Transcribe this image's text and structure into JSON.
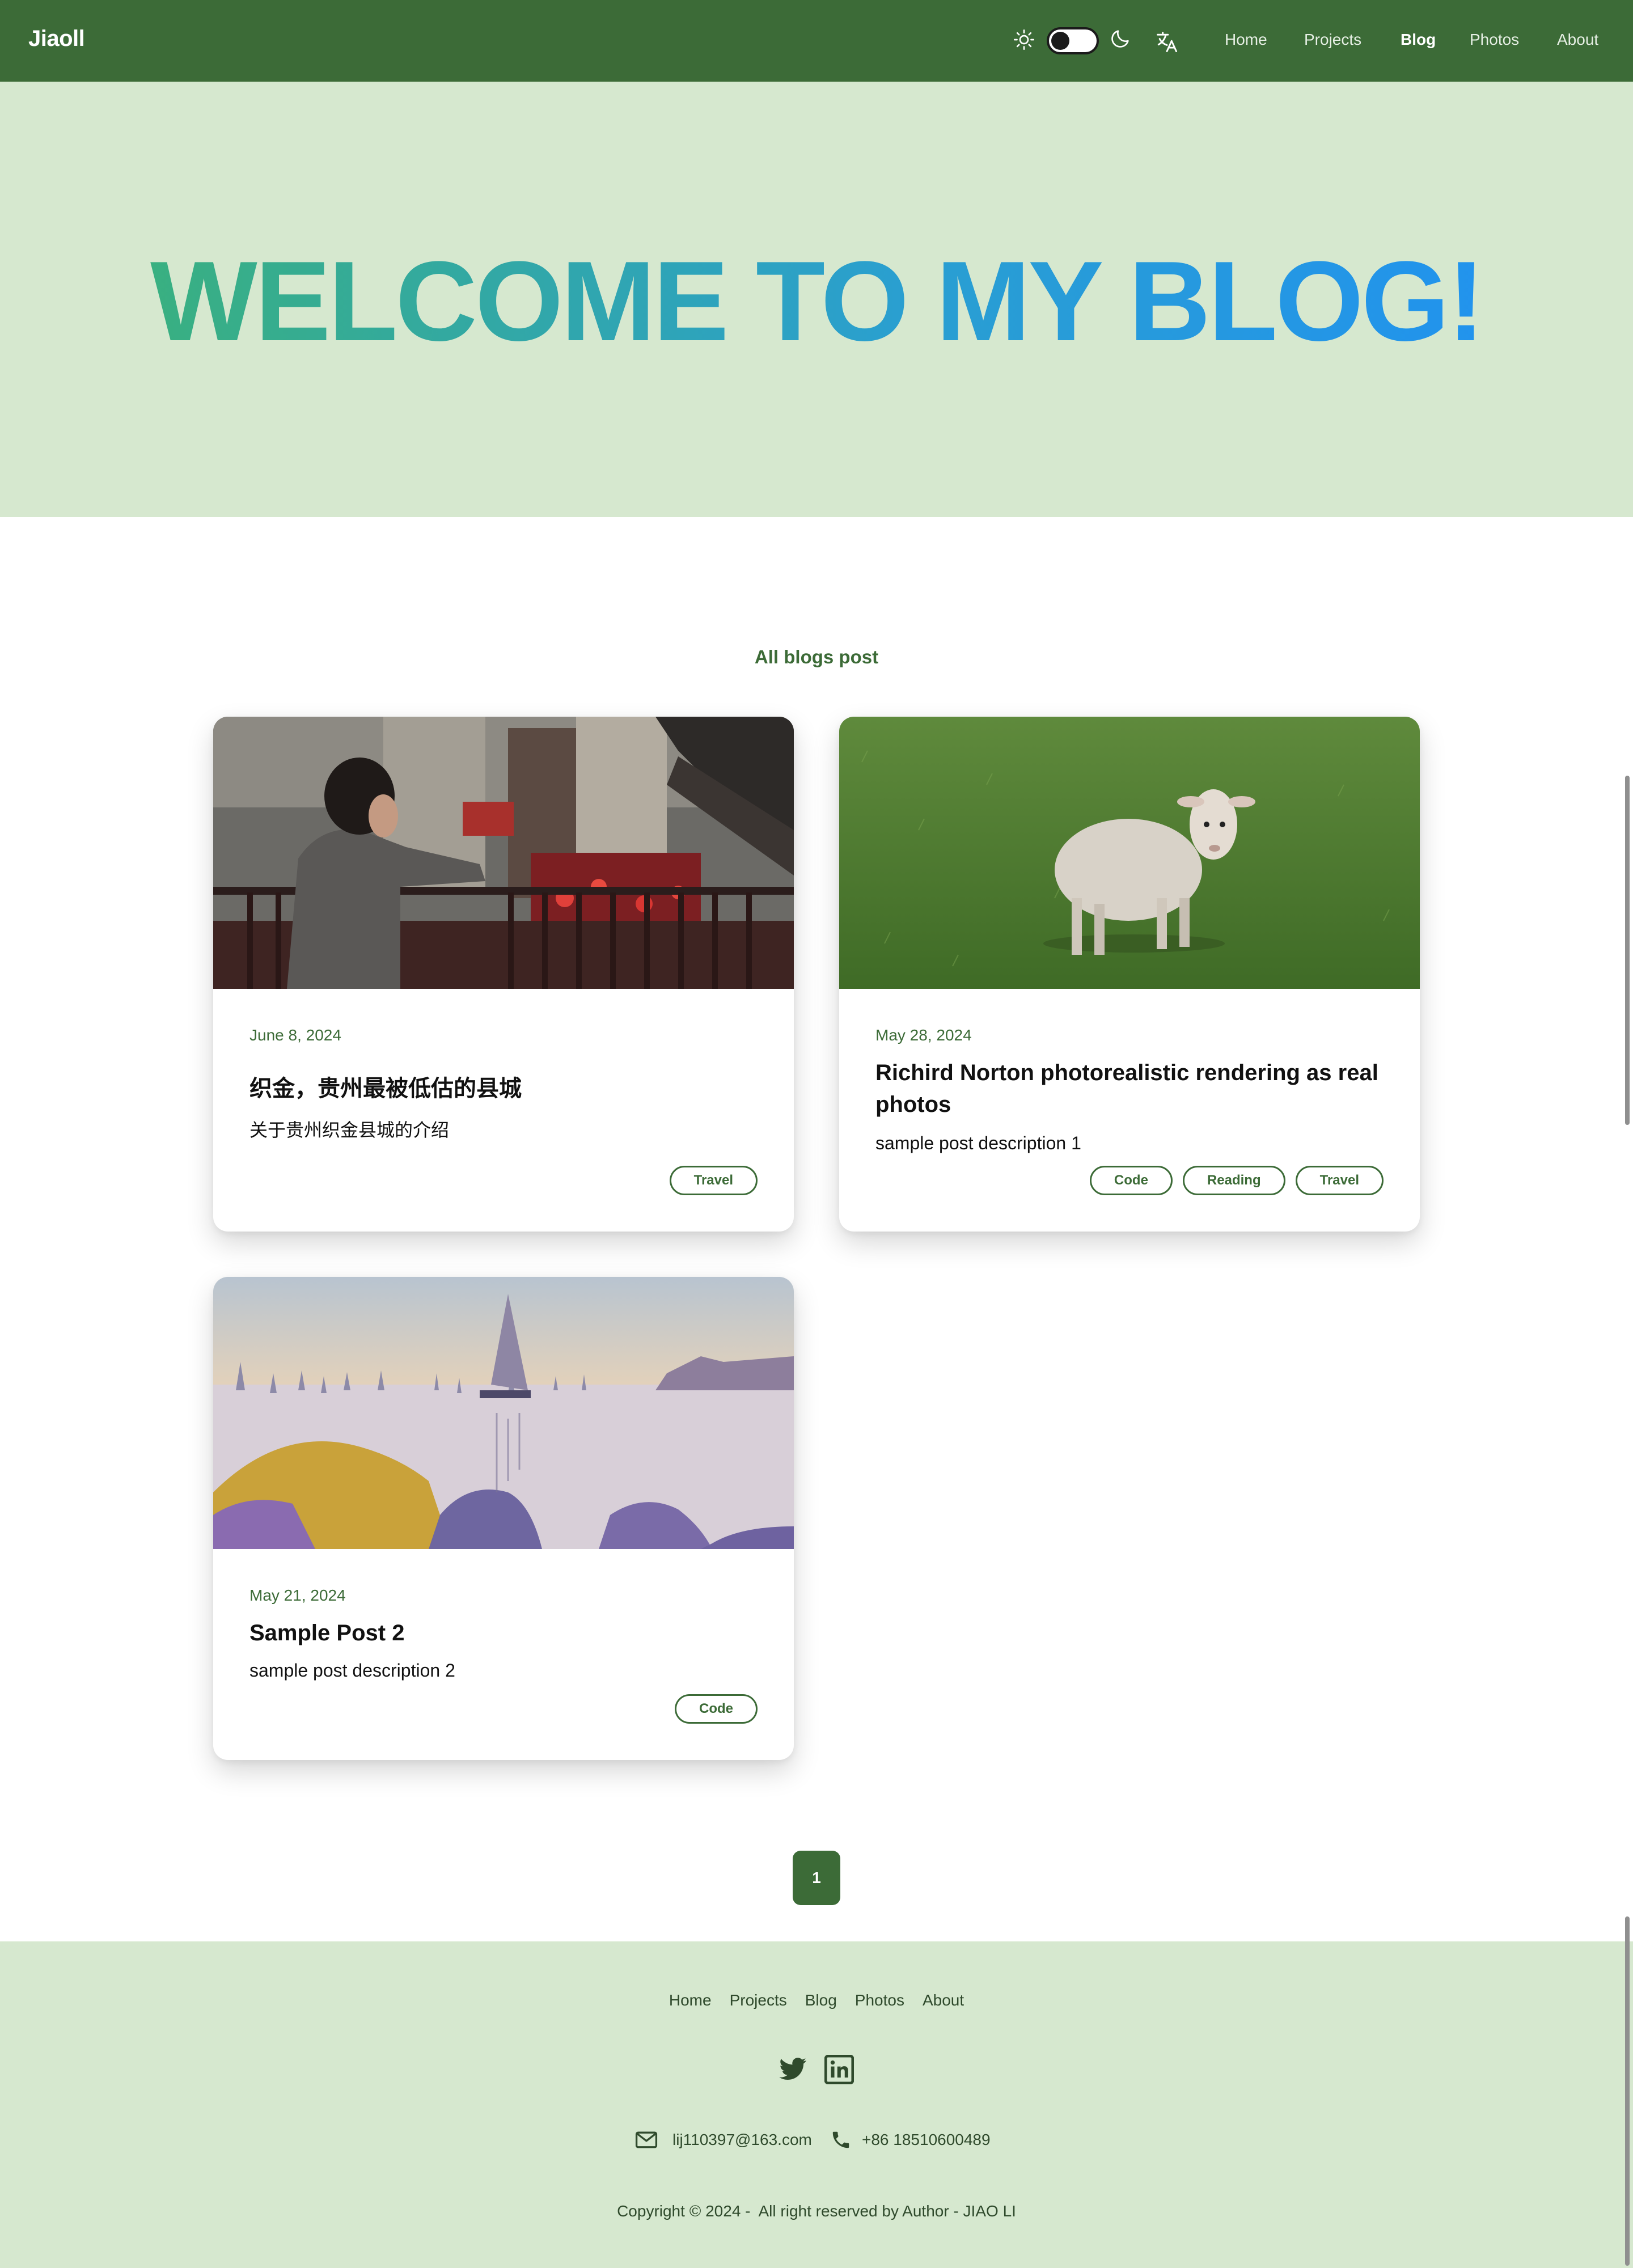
{
  "nav": {
    "brand": "Jiaoll",
    "links": [
      "Home",
      "Projects",
      "Blog",
      "Photos",
      "About"
    ],
    "active": "Blog",
    "icons": [
      "sun-icon",
      "theme-toggle",
      "moon-icon",
      "translate-icon"
    ]
  },
  "hero": {
    "title": "WELCOME TO MY BLOG!",
    "gradient_from": "#3cb371",
    "gradient_to": "#1f90f5"
  },
  "section": {
    "heading": "All blogs post"
  },
  "posts": [
    {
      "date": "June 8, 2024",
      "title": "织金，贵州最被低估的县城",
      "description": "关于贵州织金县城的介绍",
      "tags": [
        "Travel"
      ],
      "image": "photo of a young man leaning on a railing in an old town street"
    },
    {
      "date": "May 28, 2024",
      "title": "Richird Norton photorealistic rendering as real photos",
      "description": "sample post description 1",
      "tags": [
        "Code",
        "Reading",
        "Travel"
      ],
      "image": "photo of a lamb standing on green grass"
    },
    {
      "date": "May 21, 2024",
      "title": "Sample Post 2",
      "description": "sample post description 2",
      "tags": [
        "Code"
      ],
      "image": "pointillist painting of sailboats in a harbor"
    }
  ],
  "pagination": {
    "current": "1"
  },
  "footer": {
    "links": [
      "Home",
      "Projects",
      "Blog",
      "Photos",
      "About"
    ],
    "social": [
      "twitter-icon",
      "linkedin-icon"
    ],
    "email": "lij110397@163.com",
    "phone": "+86 18510600489",
    "copyright": "Copyright © 2024 -  All right reserved by Author - JIAO LI"
  },
  "colors": {
    "navbar": "#3c6b37",
    "hero_bg": "#d6e8cf",
    "accent": "#3c6b37",
    "footer_bg": "#d6e8cf"
  }
}
